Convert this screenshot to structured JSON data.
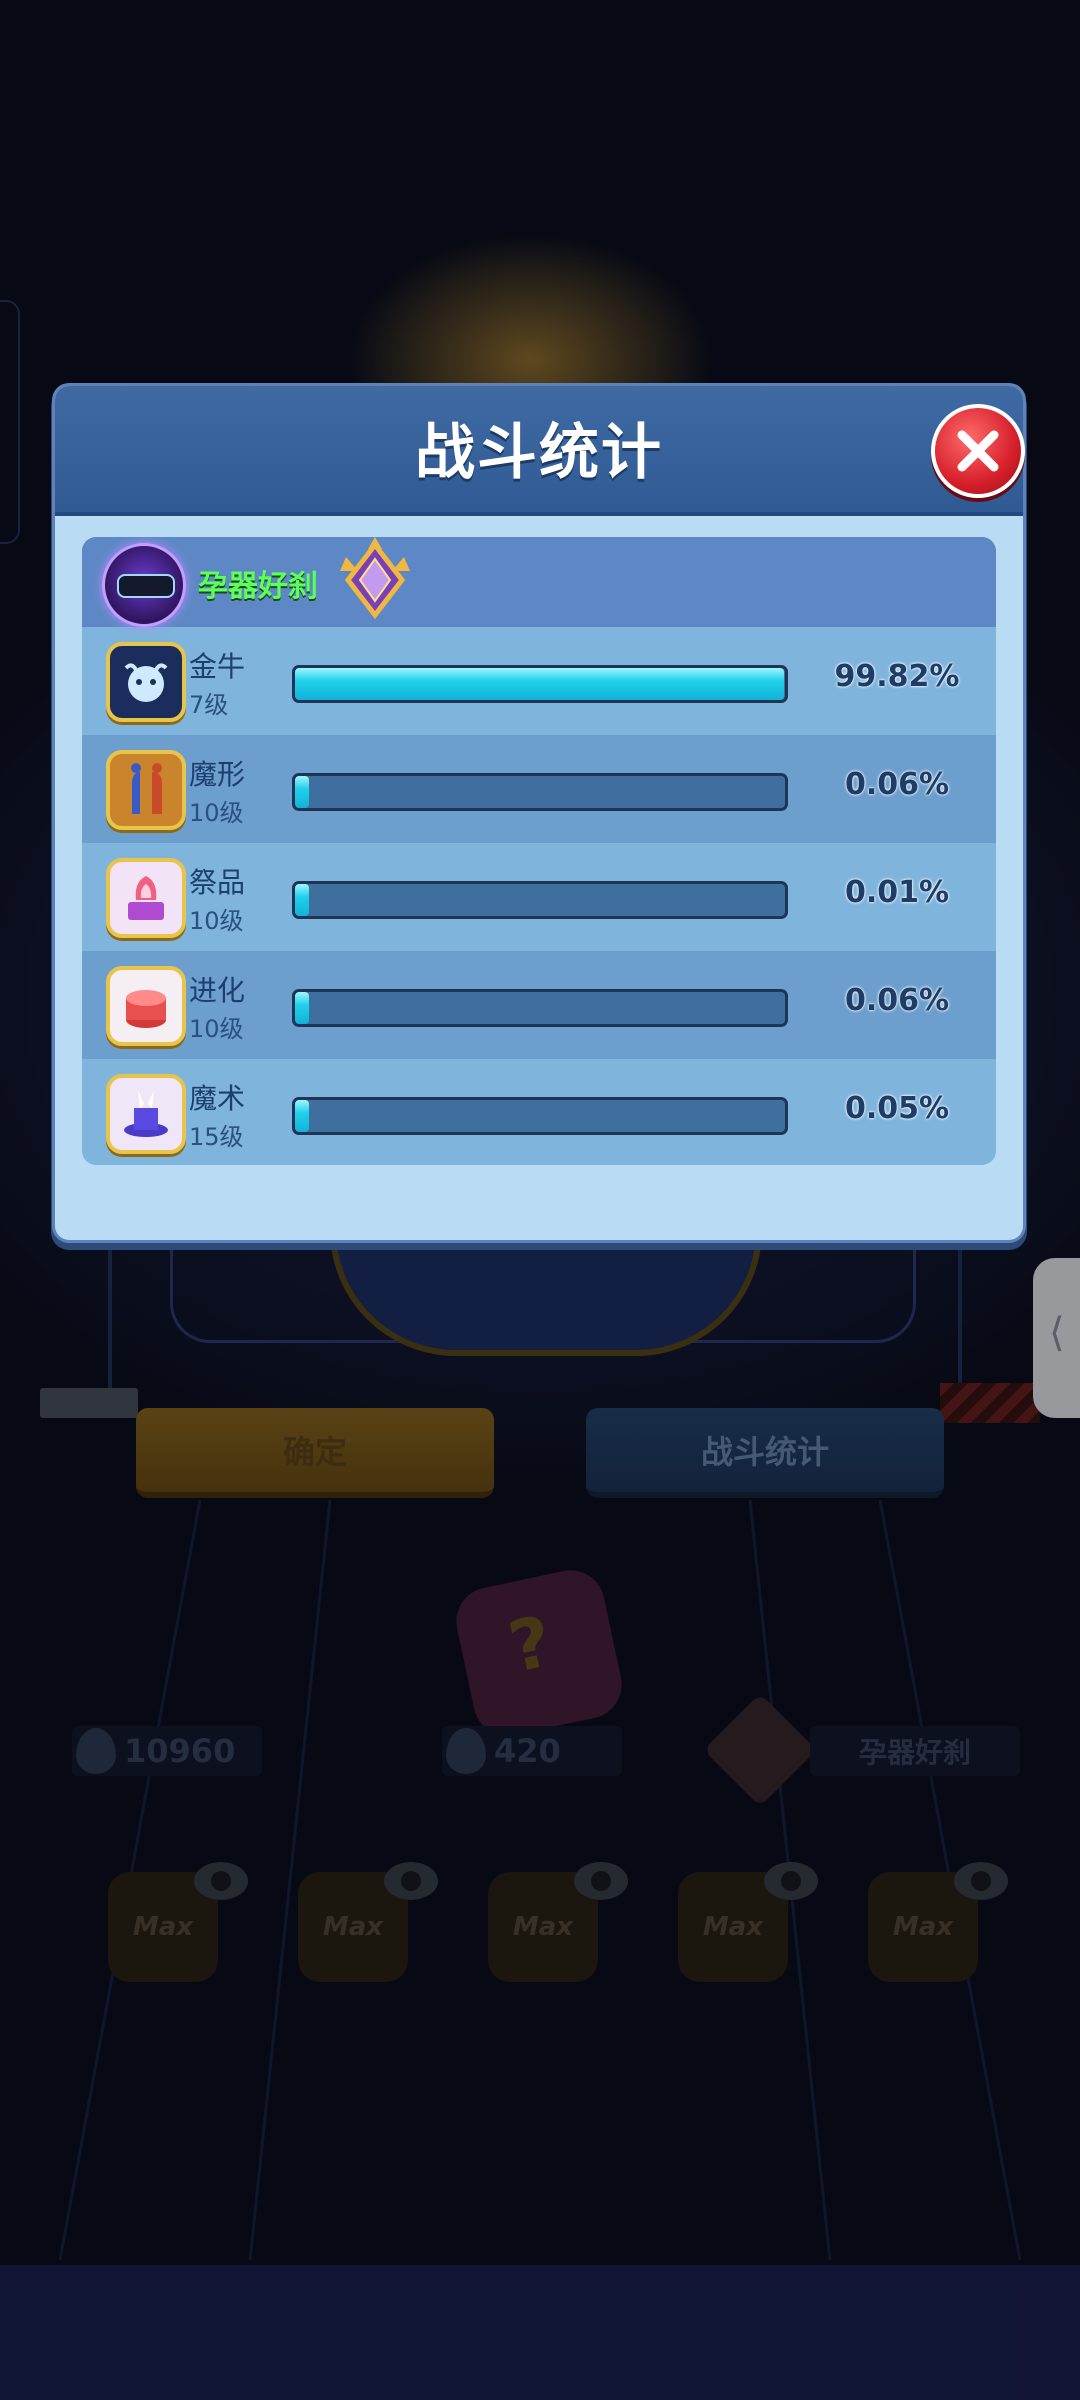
{
  "dialog": {
    "title": "战斗统计",
    "close_icon": "close-icon"
  },
  "player": {
    "name": "孕器好刹",
    "rank_icon": "rank-badge-icon"
  },
  "units": [
    {
      "name": "金牛",
      "level": "7级",
      "percent_text": "99.82%",
      "percent": 99.82,
      "icon": "golden-bull-icon",
      "icon_bg": "#1b2d5c"
    },
    {
      "name": "魔形",
      "level": "10级",
      "percent_text": "0.06%",
      "percent": 0.06,
      "icon": "shapeshifter-icon",
      "icon_bg": "#c9842c"
    },
    {
      "name": "祭品",
      "level": "10级",
      "percent_text": "0.01%",
      "percent": 0.01,
      "icon": "sacrifice-icon",
      "icon_bg": "#f2e3f7"
    },
    {
      "name": "进化",
      "level": "10级",
      "percent_text": "0.06%",
      "percent": 0.06,
      "icon": "evolution-icon",
      "icon_bg": "#f5eef2"
    },
    {
      "name": "魔术",
      "level": "15级",
      "percent_text": "0.05%",
      "percent": 0.05,
      "icon": "magic-hat-icon",
      "icon_bg": "#efe6f7"
    }
  ],
  "buttons": {
    "confirm": "确定",
    "battle_stats": "战斗统计"
  },
  "resources": {
    "currency_1": "10960",
    "currency_2": "420",
    "player_name": "孕器好刹"
  },
  "cards": [
    "Max",
    "Max",
    "Max",
    "Max",
    "Max"
  ],
  "side_tab": "⟨",
  "colors": {
    "bar_fill": "#21d0ec",
    "header": "#2f5a94",
    "panel": "#b9dcf4",
    "close_button": "#d61f2a",
    "player_name": "#5cff5c"
  }
}
